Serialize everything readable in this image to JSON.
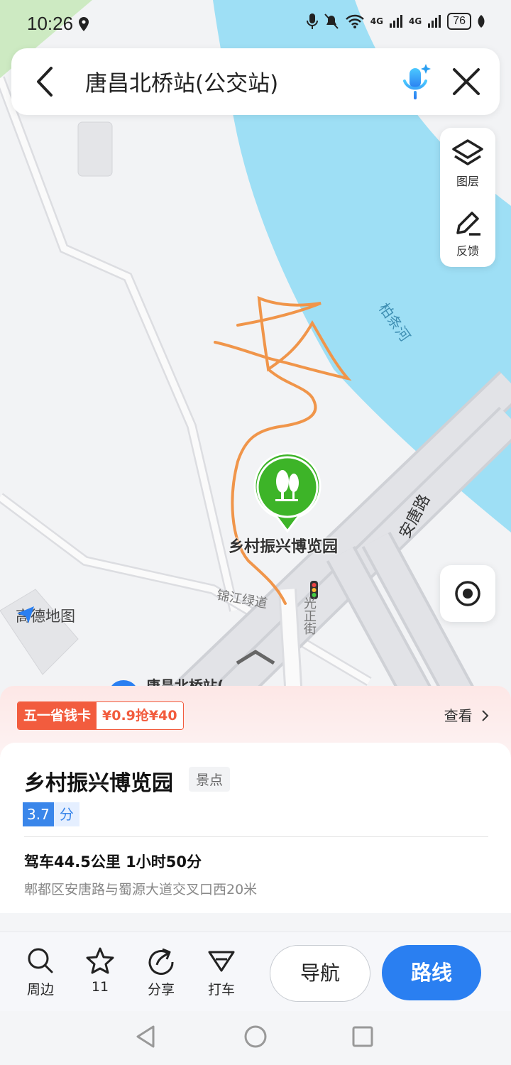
{
  "status_bar": {
    "time": "10:26",
    "network_1": "4G",
    "network_2": "4G",
    "battery": "76"
  },
  "search": {
    "title": "唐昌北桥站(公交站)"
  },
  "tools": {
    "layers_label": "图层",
    "feedback_label": "反馈"
  },
  "map": {
    "river_label": "柏条河",
    "road_label_1": "安唐路",
    "road_label_2": "锦江绿道",
    "road_label_3": "光正街",
    "poi_label": "乡村振兴博览园",
    "watermark": "高德地图",
    "bus_stop_label": "唐昌北桥站("
  },
  "promo": {
    "tag_left": "五一省钱卡",
    "tag_right": "¥0.9抢¥40",
    "view_label": "查看"
  },
  "place": {
    "name": "乡村振兴博览园",
    "category": "景点",
    "rating": "3.7",
    "rating_unit": "分",
    "drive_info": "驾车44.5公里 1小时50分",
    "address": "郫都区安唐路与蜀源大道交叉口西20米"
  },
  "actions": {
    "nearby": "周边",
    "favorite_count": "11",
    "share": "分享",
    "taxi": "打车",
    "navigate": "导航",
    "route": "路线"
  },
  "colors": {
    "primary": "#2a7ff1",
    "promo_red": "#f25c3e",
    "river": "#9edff5",
    "poi_green": "#3db428",
    "scribble": "#f0954a"
  }
}
